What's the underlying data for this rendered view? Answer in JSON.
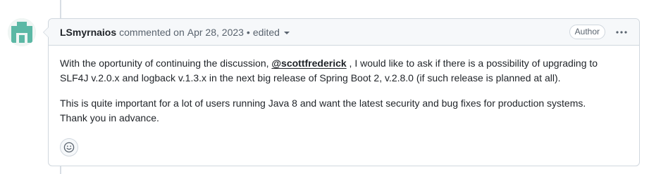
{
  "comment": {
    "author": "LSmyrnaios",
    "action": "commented on",
    "date": "Apr 28, 2023",
    "separator": "•",
    "edited_label": "edited",
    "badge": "Author",
    "body": {
      "p1_text_before": "With the oportunity of continuing the discussion, ",
      "p1_mention": "@scottfrederick",
      "p1_text_after": " , I would like to ask if there is a possibility of upgrading to SLF4J v.2.0.x and logback v.1.3.x in the next big release of Spring Boot 2, v.2.8.0 (if such release is planned at all).",
      "p2_line1": "This is quite important for a lot of users running Java 8 and want the latest security and bug fixes for production systems.",
      "p2_line2": "Thank you in advance."
    }
  },
  "icons": {
    "avatar": "identicon-avatar",
    "caret": "chevron-down-icon",
    "menu": "kebab-horizontal-icon",
    "reaction": "smiley-icon"
  },
  "colors": {
    "avatar_fill": "#5cb8a5",
    "border": "#d0d7de",
    "header_bg": "#f6f8fa",
    "muted_text": "#59636e",
    "text": "#1f2328"
  }
}
